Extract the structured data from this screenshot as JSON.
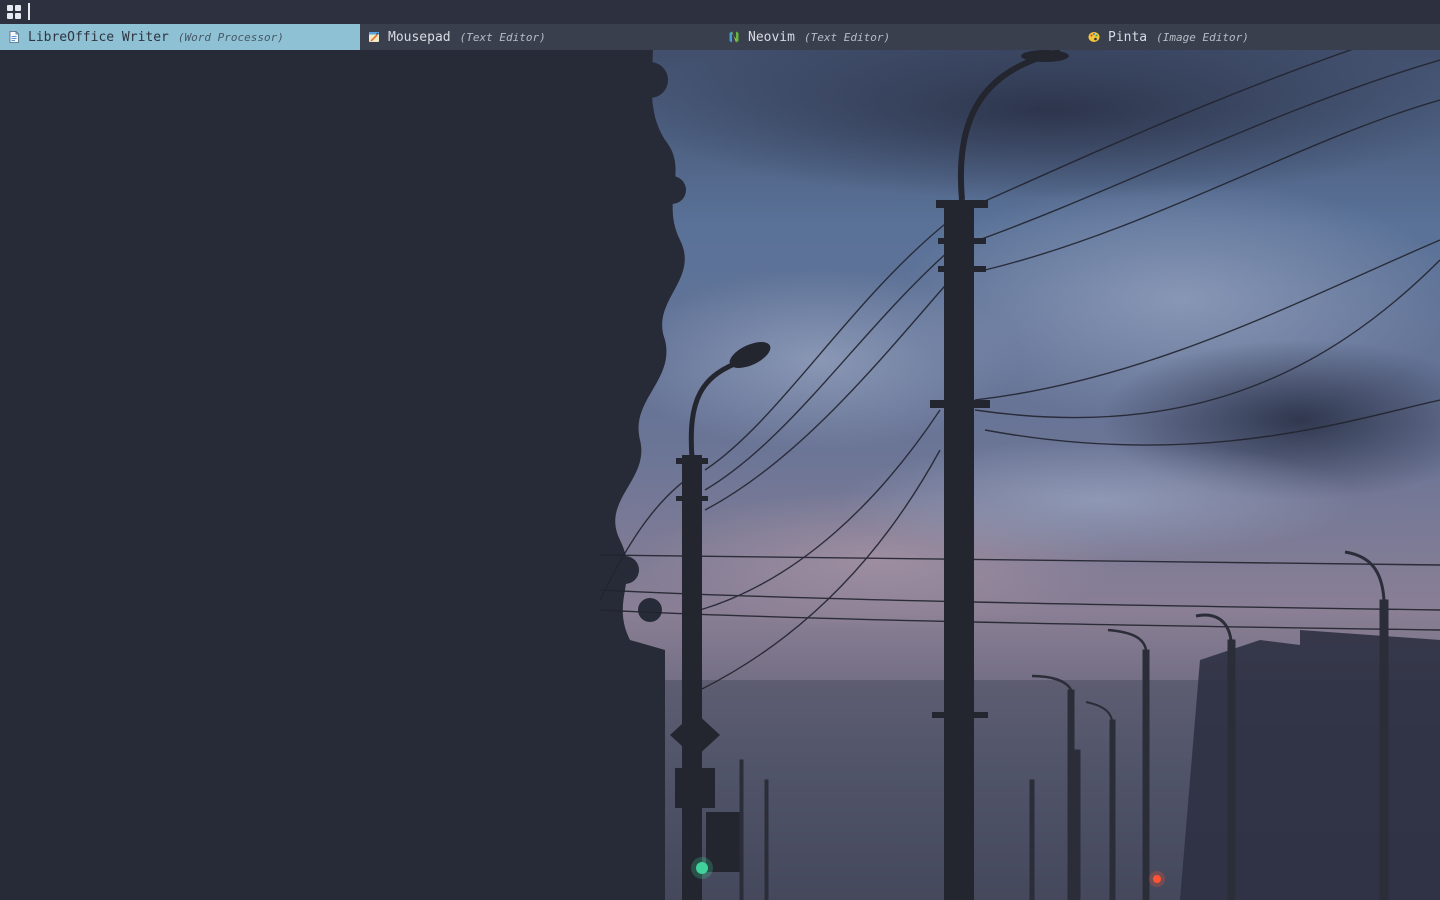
{
  "launcher": {
    "icon": "app-grid-icon",
    "search": {
      "value": "",
      "placeholder": ""
    }
  },
  "results": [
    {
      "name": "LibreOffice Writer",
      "description": "(Word Processor)",
      "icon": "libreoffice-writer-icon",
      "selected": true
    },
    {
      "name": "Mousepad",
      "description": "(Text Editor)",
      "icon": "mousepad-icon",
      "selected": false
    },
    {
      "name": "Neovim",
      "description": "(Text Editor)",
      "icon": "neovim-icon",
      "selected": false
    },
    {
      "name": "Pinta",
      "description": "(Image Editor)",
      "icon": "pinta-icon",
      "selected": false
    }
  ],
  "colors": {
    "bar_background": "#2d313f",
    "results_background": "#3a3f4e",
    "selected_background": "#8fc1d4",
    "text": "#d8dbe2",
    "selected_text": "#2e3440"
  },
  "wallpaper": {
    "subject": "dusk-street-power-lines"
  }
}
